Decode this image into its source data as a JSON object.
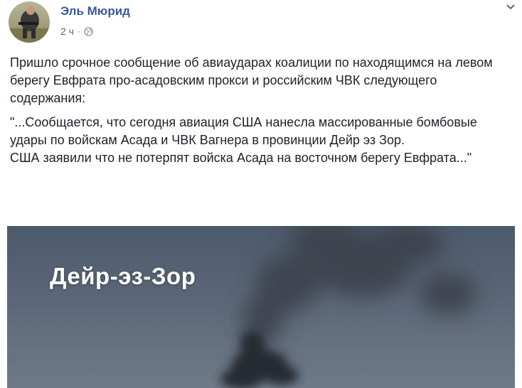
{
  "post": {
    "author": "Эль Мюрид",
    "time": "2 ч",
    "separator": "·",
    "privacy_icon": "globe-icon",
    "menu_icon": "chevron-down-icon",
    "paragraphs": [
      "Пришло срочное сообщение об авиаударах коалиции по находящимся на левом берегу Евфрата про-асадовским прокси и российским ЧВК следующего содержания:",
      "\"...Сообщается, что сегодня авиация США нанесла массированные бомбовые удары по войскам Асада и ЧВК Вагнера в провинции Дейр эз Зор.",
      "США заявили что не потерпят войска Асада на восточном берегу Евфрата...\""
    ],
    "image_caption": "Дейр-эз-Зор"
  },
  "colors": {
    "author_link": "#385898",
    "meta_text": "#616770",
    "body_text": "#1d2129",
    "photo_sky": "#56626f",
    "smoke": "#2b3038"
  }
}
